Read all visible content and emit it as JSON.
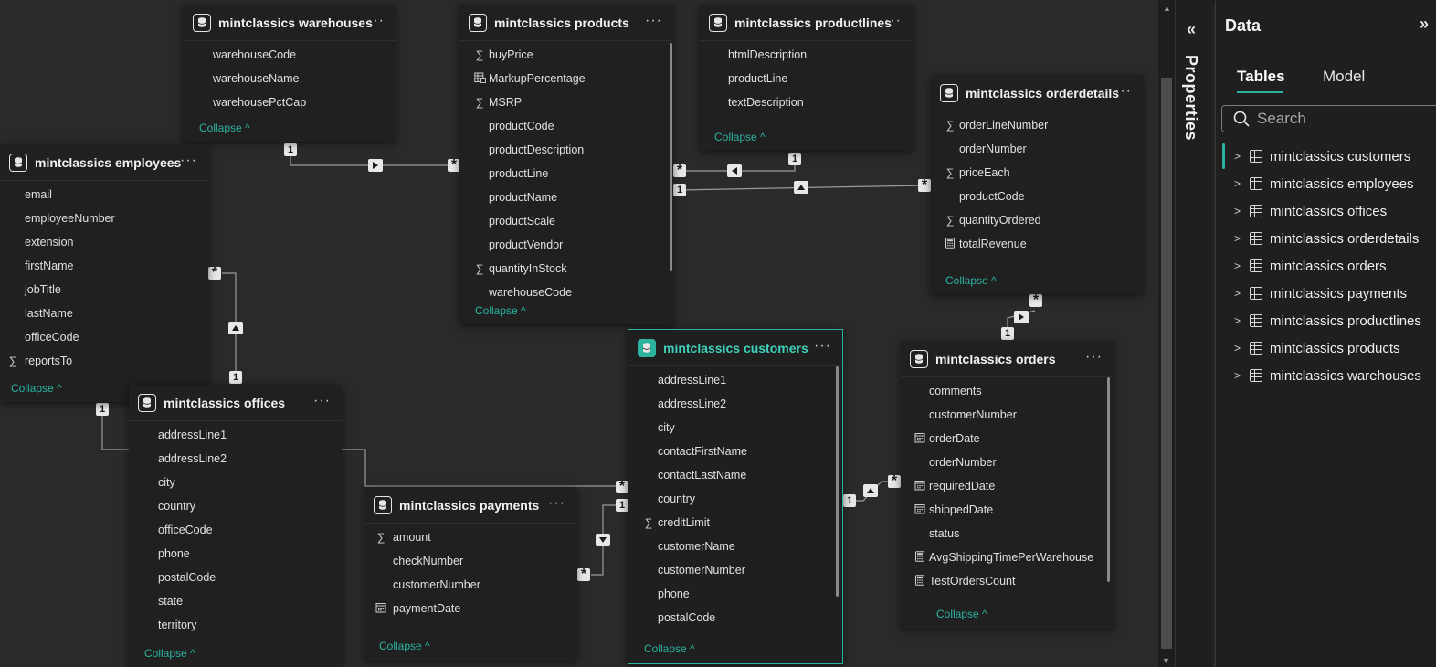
{
  "tables": {
    "warehouses": {
      "title": "mintclassics warehouses",
      "fields": [
        {
          "name": "warehouseCode",
          "icon": ""
        },
        {
          "name": "warehouseName",
          "icon": ""
        },
        {
          "name": "warehousePctCap",
          "icon": ""
        }
      ],
      "collapse": "Collapse ^"
    },
    "products": {
      "title": "mintclassics products",
      "fields": [
        {
          "name": "buyPrice",
          "icon": "sigma"
        },
        {
          "name": "MarkupPercentage",
          "icon": "calc-table"
        },
        {
          "name": "MSRP",
          "icon": "sigma"
        },
        {
          "name": "productCode",
          "icon": ""
        },
        {
          "name": "productDescription",
          "icon": ""
        },
        {
          "name": "productLine",
          "icon": ""
        },
        {
          "name": "productName",
          "icon": ""
        },
        {
          "name": "productScale",
          "icon": ""
        },
        {
          "name": "productVendor",
          "icon": ""
        },
        {
          "name": "quantityInStock",
          "icon": "sigma"
        },
        {
          "name": "warehouseCode",
          "icon": ""
        }
      ],
      "collapse": "Collapse ^"
    },
    "productlines": {
      "title": "mintclassics productlines",
      "fields": [
        {
          "name": "htmlDescription",
          "icon": ""
        },
        {
          "name": "productLine",
          "icon": ""
        },
        {
          "name": "textDescription",
          "icon": ""
        }
      ],
      "collapse": "Collapse ^"
    },
    "orderdetails": {
      "title": "mintclassics orderdetails",
      "fields": [
        {
          "name": "orderLineNumber",
          "icon": "sigma"
        },
        {
          "name": "orderNumber",
          "icon": ""
        },
        {
          "name": "priceEach",
          "icon": "sigma"
        },
        {
          "name": "productCode",
          "icon": ""
        },
        {
          "name": "quantityOrdered",
          "icon": "sigma"
        },
        {
          "name": "totalRevenue",
          "icon": "calculator"
        }
      ],
      "collapse": "Collapse ^"
    },
    "employees": {
      "title": "mintclassics employees",
      "fields": [
        {
          "name": "email",
          "icon": ""
        },
        {
          "name": "employeeNumber",
          "icon": ""
        },
        {
          "name": "extension",
          "icon": ""
        },
        {
          "name": "firstName",
          "icon": ""
        },
        {
          "name": "jobTitle",
          "icon": ""
        },
        {
          "name": "lastName",
          "icon": ""
        },
        {
          "name": "officeCode",
          "icon": ""
        },
        {
          "name": "reportsTo",
          "icon": "sigma"
        }
      ],
      "collapse": "Collapse ^"
    },
    "offices": {
      "title": "mintclassics offices",
      "fields": [
        {
          "name": "addressLine1",
          "icon": ""
        },
        {
          "name": "addressLine2",
          "icon": ""
        },
        {
          "name": "city",
          "icon": ""
        },
        {
          "name": "country",
          "icon": ""
        },
        {
          "name": "officeCode",
          "icon": ""
        },
        {
          "name": "phone",
          "icon": ""
        },
        {
          "name": "postalCode",
          "icon": ""
        },
        {
          "name": "state",
          "icon": ""
        },
        {
          "name": "territory",
          "icon": ""
        }
      ],
      "collapse": "Collapse ^"
    },
    "payments": {
      "title": "mintclassics payments",
      "fields": [
        {
          "name": "amount",
          "icon": "sigma"
        },
        {
          "name": "checkNumber",
          "icon": ""
        },
        {
          "name": "customerNumber",
          "icon": ""
        },
        {
          "name": "paymentDate",
          "icon": "calendar"
        }
      ],
      "collapse": "Collapse ^"
    },
    "customers": {
      "title": "mintclassics customers",
      "fields": [
        {
          "name": "addressLine1",
          "icon": ""
        },
        {
          "name": "addressLine2",
          "icon": ""
        },
        {
          "name": "city",
          "icon": ""
        },
        {
          "name": "contactFirstName",
          "icon": ""
        },
        {
          "name": "contactLastName",
          "icon": ""
        },
        {
          "name": "country",
          "icon": ""
        },
        {
          "name": "creditLimit",
          "icon": "sigma"
        },
        {
          "name": "customerName",
          "icon": ""
        },
        {
          "name": "customerNumber",
          "icon": ""
        },
        {
          "name": "phone",
          "icon": ""
        },
        {
          "name": "postalCode",
          "icon": ""
        }
      ],
      "collapse": "Collapse ^"
    },
    "orders": {
      "title": "mintclassics orders",
      "fields": [
        {
          "name": "comments",
          "icon": ""
        },
        {
          "name": "customerNumber",
          "icon": ""
        },
        {
          "name": "orderDate",
          "icon": "calendar"
        },
        {
          "name": "orderNumber",
          "icon": ""
        },
        {
          "name": "requiredDate",
          "icon": "calendar"
        },
        {
          "name": "shippedDate",
          "icon": "calendar"
        },
        {
          "name": "status",
          "icon": ""
        },
        {
          "name": "AvgShippingTimePerWarehouse",
          "icon": "calculator"
        },
        {
          "name": "TestOrdersCount",
          "icon": "calculator"
        }
      ],
      "collapse": "Collapse ^"
    }
  },
  "cardinality": {
    "one": "1",
    "many": "*"
  },
  "more_glyph": "···",
  "properties_pane": {
    "label": "Properties",
    "expand_glyph": "«"
  },
  "data_pane": {
    "title": "Data",
    "close_glyph": "»",
    "tabs": [
      {
        "label": "Tables",
        "active": true
      },
      {
        "label": "Model",
        "active": false
      }
    ],
    "search_placeholder": "Search",
    "tables": [
      "mintclassics customers",
      "mintclassics employees",
      "mintclassics offices",
      "mintclassics orderdetails",
      "mintclassics orders",
      "mintclassics payments",
      "mintclassics productlines",
      "mintclassics products",
      "mintclassics warehouses"
    ],
    "active_table": "mintclassics customers"
  },
  "colors": {
    "accent": "#2bb3a0",
    "canvas": "#2a2a2a",
    "card": "#202020",
    "line": "#9a9a9a"
  }
}
